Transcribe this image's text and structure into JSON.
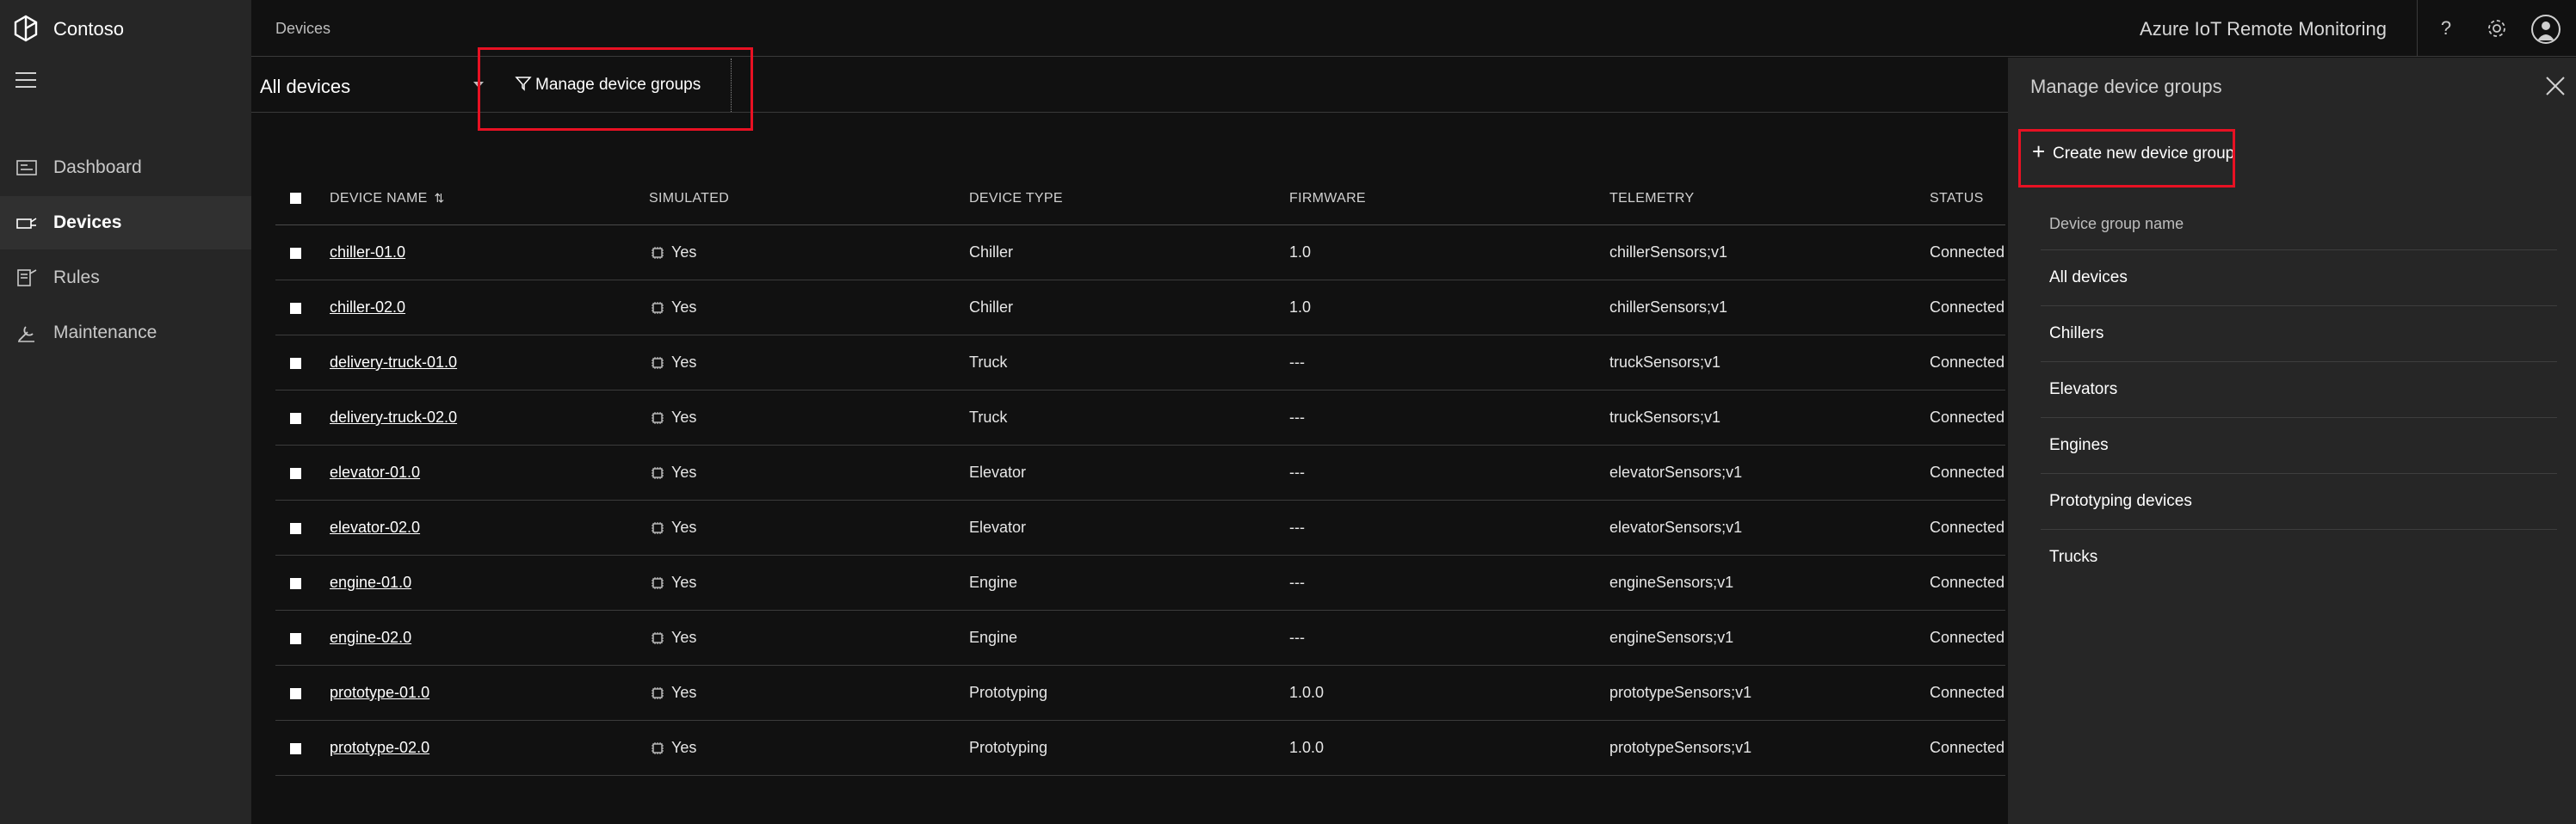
{
  "brand": {
    "name": "Contoso"
  },
  "nav": {
    "items": [
      {
        "label": "Dashboard",
        "icon": "dashboard-icon",
        "active": false
      },
      {
        "label": "Devices",
        "icon": "devices-icon",
        "active": true
      },
      {
        "label": "Rules",
        "icon": "rules-icon",
        "active": false
      },
      {
        "label": "Maintenance",
        "icon": "maintenance-icon",
        "active": false
      }
    ]
  },
  "header": {
    "breadcrumb": "Devices",
    "app_title": "Azure IoT Remote Monitoring",
    "help": "?"
  },
  "context": {
    "selected_group": "All devices",
    "manage_label": "Manage device groups"
  },
  "table": {
    "columns": [
      "DEVICE NAME",
      "SIMULATED",
      "DEVICE TYPE",
      "FIRMWARE",
      "TELEMETRY",
      "STATUS"
    ],
    "sort_icon": "⇅",
    "rows": [
      {
        "name": "chiller-01.0",
        "simulated": "Yes",
        "type": "Chiller",
        "firmware": "1.0",
        "telemetry": "chillerSensors;v1",
        "status": "Connected"
      },
      {
        "name": "chiller-02.0",
        "simulated": "Yes",
        "type": "Chiller",
        "firmware": "1.0",
        "telemetry": "chillerSensors;v1",
        "status": "Connected"
      },
      {
        "name": "delivery-truck-01.0",
        "simulated": "Yes",
        "type": "Truck",
        "firmware": "---",
        "telemetry": "truckSensors;v1",
        "status": "Connected"
      },
      {
        "name": "delivery-truck-02.0",
        "simulated": "Yes",
        "type": "Truck",
        "firmware": "---",
        "telemetry": "truckSensors;v1",
        "status": "Connected"
      },
      {
        "name": "elevator-01.0",
        "simulated": "Yes",
        "type": "Elevator",
        "firmware": "---",
        "telemetry": "elevatorSensors;v1",
        "status": "Connected"
      },
      {
        "name": "elevator-02.0",
        "simulated": "Yes",
        "type": "Elevator",
        "firmware": "---",
        "telemetry": "elevatorSensors;v1",
        "status": "Connected"
      },
      {
        "name": "engine-01.0",
        "simulated": "Yes",
        "type": "Engine",
        "firmware": "---",
        "telemetry": "engineSensors;v1",
        "status": "Connected"
      },
      {
        "name": "engine-02.0",
        "simulated": "Yes",
        "type": "Engine",
        "firmware": "---",
        "telemetry": "engineSensors;v1",
        "status": "Connected"
      },
      {
        "name": "prototype-01.0",
        "simulated": "Yes",
        "type": "Prototyping",
        "firmware": "1.0.0",
        "telemetry": "prototypeSensors;v1",
        "status": "Connected"
      },
      {
        "name": "prototype-02.0",
        "simulated": "Yes",
        "type": "Prototyping",
        "firmware": "1.0.0",
        "telemetry": "prototypeSensors;v1",
        "status": "Connected"
      }
    ]
  },
  "flyout": {
    "title": "Manage device groups",
    "create_plus": "+",
    "create_label": "Create new device group",
    "column_header": "Device group name",
    "groups": [
      "All devices",
      "Chillers",
      "Elevators",
      "Engines",
      "Prototyping devices",
      "Trucks"
    ]
  },
  "colors": {
    "highlight": "#e81123",
    "background": "#111111",
    "panel": "#262626"
  }
}
